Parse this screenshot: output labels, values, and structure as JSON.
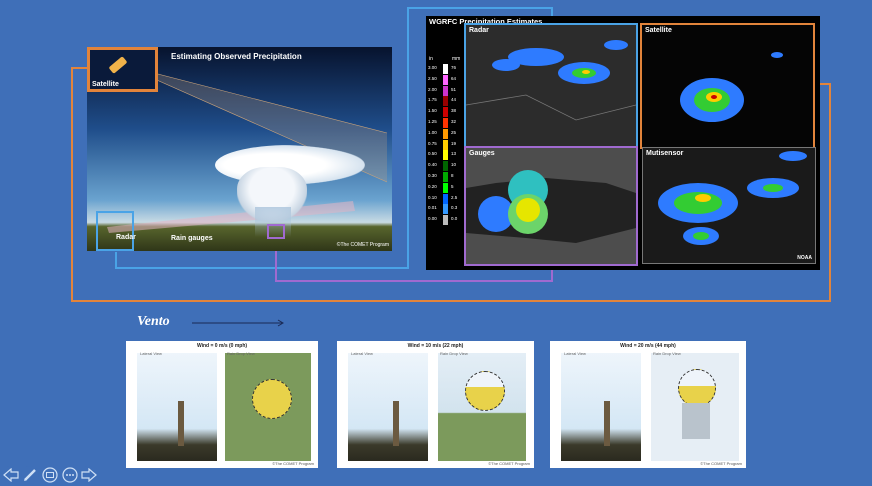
{
  "slide": {
    "left_image": {
      "title": "Estimating Observed Precipitation",
      "labels": {
        "satellite": "Satellite",
        "radar": "Radar",
        "rain_gauges": "Rain gauges"
      },
      "credit": "©The COMET Program"
    },
    "right_image": {
      "title": "WGRFC Precipitation Estimates",
      "legend": {
        "in_label": "in",
        "mm_label": "mm",
        "rows": [
          {
            "in": "3.00",
            "mm": "76",
            "color": "#ffffff"
          },
          {
            "in": "2.50",
            "mm": "64",
            "color": "#ff66ff"
          },
          {
            "in": "2.00",
            "mm": "51",
            "color": "#cc33cc"
          },
          {
            "in": "1.75",
            "mm": "44",
            "color": "#990000"
          },
          {
            "in": "1.50",
            "mm": "38",
            "color": "#cc0000"
          },
          {
            "in": "1.25",
            "mm": "32",
            "color": "#ff3300"
          },
          {
            "in": "1.00",
            "mm": "25",
            "color": "#ff9900"
          },
          {
            "in": "0.75",
            "mm": "19",
            "color": "#ffcc00"
          },
          {
            "in": "0.50",
            "mm": "13",
            "color": "#ffff00"
          },
          {
            "in": "0.40",
            "mm": "10",
            "color": "#006600"
          },
          {
            "in": "0.30",
            "mm": "8",
            "color": "#00aa00"
          },
          {
            "in": "0.20",
            "mm": "5",
            "color": "#00ff00"
          },
          {
            "in": "0.10",
            "mm": "2.5",
            "color": "#0066ff"
          },
          {
            "in": "0.01",
            "mm": "0.3",
            "color": "#3399ff"
          },
          {
            "in": "0.00",
            "mm": "0.0",
            "color": "#bbbbbb"
          }
        ]
      },
      "panels": {
        "radar": "Radar",
        "satellite": "Satellite",
        "gauges": "Gauges",
        "multisensor": "Mutisensor"
      },
      "credit": "NOAA"
    },
    "vento_label": "Vento",
    "cards": [
      {
        "title": "Wind = 0 m/s (0 mph)",
        "lateral": "Lateral View",
        "raindrop": "Rain Drop View",
        "credit": "©The COMET Program"
      },
      {
        "title": "Wind = 10 m/s (22 mph)",
        "lateral": "Lateral View",
        "raindrop": "Rain Drop View",
        "credit": "©The COMET Program"
      },
      {
        "title": "Wind = 20 m/s (44 mph)",
        "lateral": "Lateral View",
        "raindrop": "Rain Drop View",
        "credit": "©The COMET Program"
      }
    ]
  },
  "colors": {
    "background": "#3f6fb8",
    "orange": "#e2843b",
    "blue": "#4aa3e6",
    "purple": "#a06ad0"
  }
}
